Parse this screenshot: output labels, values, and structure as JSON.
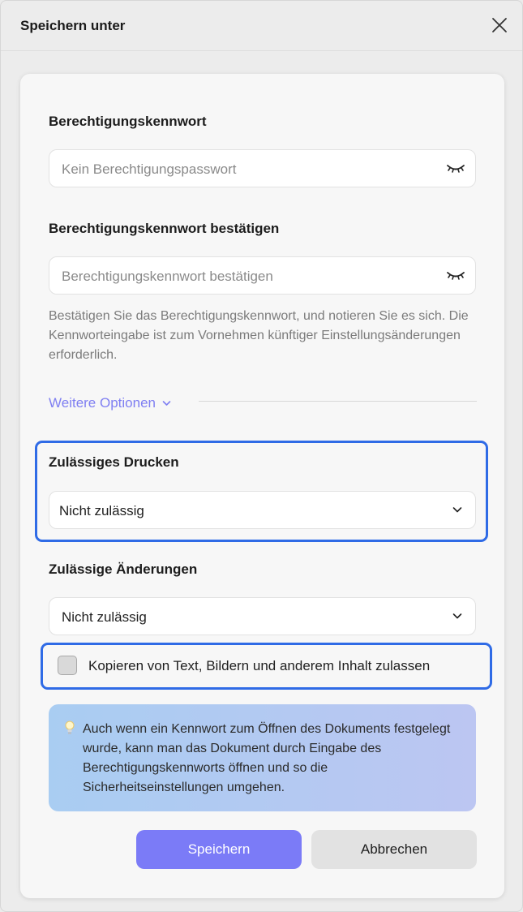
{
  "dialog": {
    "title": "Speichern unter"
  },
  "permission_password": {
    "label": "Berechtigungskennwort",
    "placeholder": "Kein Berechtigungspasswort"
  },
  "confirm_password": {
    "label": "Berechtigungskennwort bestätigen",
    "placeholder": "Berechtigungskennwort bestätigen"
  },
  "hint_text": "Bestätigen Sie das Berechtigungskennwort, und notieren Sie es sich. Die Kennworteingabe ist zum Vornehmen künftiger Einstellungsänderungen erforderlich.",
  "more_options": {
    "label": "Weitere Optionen"
  },
  "printing": {
    "label": "Zulässiges Drucken",
    "selected": "Nicht zulässig"
  },
  "changes": {
    "label": "Zulässige Änderungen",
    "selected": "Nicht zulässig"
  },
  "copy_option": {
    "label": "Kopieren von Text, Bildern und anderem Inhalt zulassen",
    "checked": false
  },
  "info_box": {
    "text": "Auch wenn ein Kennwort zum Öffnen des Dokuments festgelegt wurde, kann man das Dokument durch Eingabe des Berechtigungskennworts öffnen und so die Sicherheitseinstellungen umgehen."
  },
  "buttons": {
    "save": "Speichern",
    "cancel": "Abbrechen"
  },
  "colors": {
    "accent": "#7b7bf7",
    "link": "#7f7ff2",
    "highlight_border": "#2f6be6"
  },
  "icons": {
    "close": "close-icon",
    "eye": "eye-closed-icon",
    "chevron": "chevron-down-icon",
    "bulb": "lightbulb-icon"
  }
}
